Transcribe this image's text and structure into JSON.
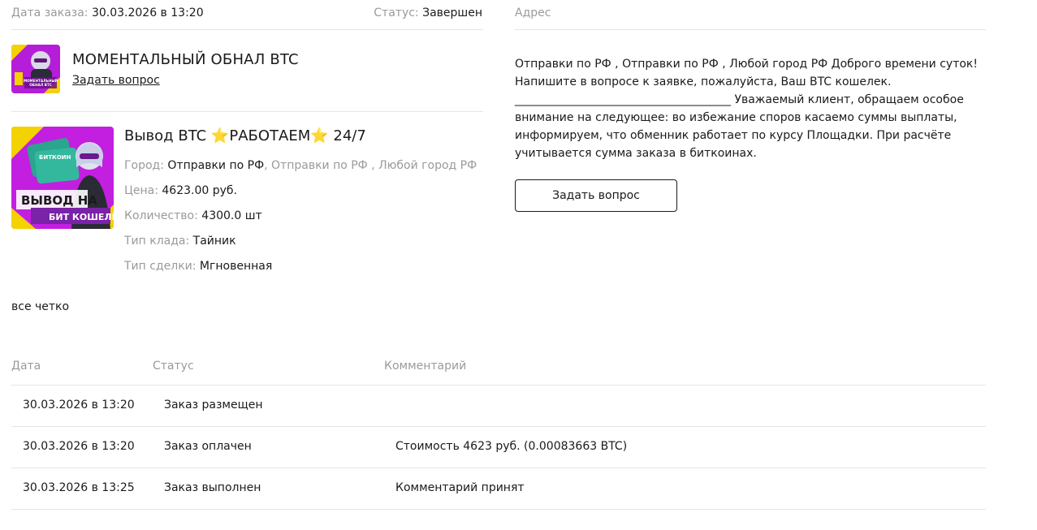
{
  "order": {
    "date_label": "Дата заказа:",
    "date_value": "30.03.2026 в 13:20",
    "status_label": "Статус:",
    "status_value": "Завершен"
  },
  "address": {
    "label": "Адрес",
    "text": "Отправки по РФ , Отправки по РФ , Любой город РФ Доброго времени суток! Напишите в вопросе к заявке, пожалуйста, Ваш BTC кошелек. ______________________________________ Уважаемый клиент, обращаем особое внимание на следующее: во избежание споров касаемо суммы выплаты, информируем, что обменник работает по курсу Площадки. При расчёте учитывается сумма заказа в биткоинах.",
    "ask_button": "Задать вопрос"
  },
  "shop": {
    "name": "МОМЕНТАЛЬНЫЙ ОБНАЛ BTC",
    "ask_link": "Задать вопрос",
    "thumb_text": "МОМЕНТАЛЬНЫЙ ОБНАЛ BTC"
  },
  "product": {
    "title": "Вывод BTC ⭐РАБОТАЕМ⭐ 24/7",
    "thumb_text_top": "БИТКОИН",
    "thumb_text_1": "ВЫВОД НА",
    "thumb_text_2": "БИТ КОШЕЛЁК",
    "city_label": "Город:",
    "city_primary": "Отправки по РФ",
    "city_secondary": ", Отправки по РФ , Любой город РФ",
    "price_label": "Цена:",
    "price_value": "4623.00 руб.",
    "qty_label": "Количество:",
    "qty_value": "4300.0 шт",
    "stash_label": "Тип клада:",
    "stash_value": "Тайник",
    "deal_label": "Тип сделки:",
    "deal_value": "Мгновенная"
  },
  "note": "все четко",
  "history": {
    "headers": [
      "Дата",
      "Статус",
      "Комментарий"
    ],
    "rows": [
      {
        "date": "30.03.2026 в 13:20",
        "status": "Заказ размещен",
        "comment": ""
      },
      {
        "date": "30.03.2026 в 13:20",
        "status": "Заказ оплачен",
        "comment": "Стоимость 4623 руб. (0.00083663 BTC)"
      },
      {
        "date": "30.03.2026 в 13:25",
        "status": "Заказ выполнен",
        "comment": "Комментарий принят"
      }
    ]
  },
  "colors": {
    "text": "#1a1a1a",
    "muted": "#9a9a9a",
    "divider": "#e6e6e6",
    "thumb_purple": "#b51dd8",
    "thumb_yellow": "#f4d200",
    "thumb_teal": "#2aa58e"
  }
}
